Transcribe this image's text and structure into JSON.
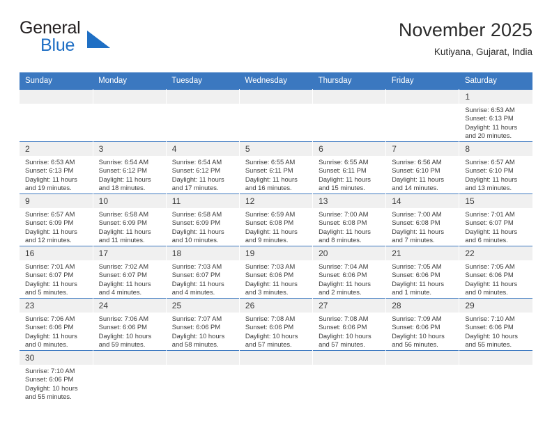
{
  "brand": {
    "name_top": "General",
    "name_bottom": "Blue",
    "triangle_icon": "triangle-icon",
    "color_black": "#231f20",
    "color_blue": "#1f6fc4"
  },
  "header": {
    "title": "November 2025",
    "subtitle": "Kutiyana, Gujarat, India"
  },
  "theme": {
    "header_blue": "#3b78c0",
    "daynum_band": "#f0f0f0",
    "text": "#3a3a3a"
  },
  "weekday_headers": [
    "Sunday",
    "Monday",
    "Tuesday",
    "Wednesday",
    "Thursday",
    "Friday",
    "Saturday"
  ],
  "weeks": [
    [
      {
        "day": "",
        "empty": true,
        "sunrise": "",
        "sunset": "",
        "daylight_line1": "",
        "daylight_line2": ""
      },
      {
        "day": "",
        "empty": true,
        "sunrise": "",
        "sunset": "",
        "daylight_line1": "",
        "daylight_line2": ""
      },
      {
        "day": "",
        "empty": true,
        "sunrise": "",
        "sunset": "",
        "daylight_line1": "",
        "daylight_line2": ""
      },
      {
        "day": "",
        "empty": true,
        "sunrise": "",
        "sunset": "",
        "daylight_line1": "",
        "daylight_line2": ""
      },
      {
        "day": "",
        "empty": true,
        "sunrise": "",
        "sunset": "",
        "daylight_line1": "",
        "daylight_line2": ""
      },
      {
        "day": "",
        "empty": true,
        "sunrise": "",
        "sunset": "",
        "daylight_line1": "",
        "daylight_line2": ""
      },
      {
        "day": "1",
        "empty": false,
        "sunrise": "Sunrise: 6:53 AM",
        "sunset": "Sunset: 6:13 PM",
        "daylight_line1": "Daylight: 11 hours",
        "daylight_line2": "and 20 minutes."
      }
    ],
    [
      {
        "day": "2",
        "empty": false,
        "sunrise": "Sunrise: 6:53 AM",
        "sunset": "Sunset: 6:13 PM",
        "daylight_line1": "Daylight: 11 hours",
        "daylight_line2": "and 19 minutes."
      },
      {
        "day": "3",
        "empty": false,
        "sunrise": "Sunrise: 6:54 AM",
        "sunset": "Sunset: 6:12 PM",
        "daylight_line1": "Daylight: 11 hours",
        "daylight_line2": "and 18 minutes."
      },
      {
        "day": "4",
        "empty": false,
        "sunrise": "Sunrise: 6:54 AM",
        "sunset": "Sunset: 6:12 PM",
        "daylight_line1": "Daylight: 11 hours",
        "daylight_line2": "and 17 minutes."
      },
      {
        "day": "5",
        "empty": false,
        "sunrise": "Sunrise: 6:55 AM",
        "sunset": "Sunset: 6:11 PM",
        "daylight_line1": "Daylight: 11 hours",
        "daylight_line2": "and 16 minutes."
      },
      {
        "day": "6",
        "empty": false,
        "sunrise": "Sunrise: 6:55 AM",
        "sunset": "Sunset: 6:11 PM",
        "daylight_line1": "Daylight: 11 hours",
        "daylight_line2": "and 15 minutes."
      },
      {
        "day": "7",
        "empty": false,
        "sunrise": "Sunrise: 6:56 AM",
        "sunset": "Sunset: 6:10 PM",
        "daylight_line1": "Daylight: 11 hours",
        "daylight_line2": "and 14 minutes."
      },
      {
        "day": "8",
        "empty": false,
        "sunrise": "Sunrise: 6:57 AM",
        "sunset": "Sunset: 6:10 PM",
        "daylight_line1": "Daylight: 11 hours",
        "daylight_line2": "and 13 minutes."
      }
    ],
    [
      {
        "day": "9",
        "empty": false,
        "sunrise": "Sunrise: 6:57 AM",
        "sunset": "Sunset: 6:09 PM",
        "daylight_line1": "Daylight: 11 hours",
        "daylight_line2": "and 12 minutes."
      },
      {
        "day": "10",
        "empty": false,
        "sunrise": "Sunrise: 6:58 AM",
        "sunset": "Sunset: 6:09 PM",
        "daylight_line1": "Daylight: 11 hours",
        "daylight_line2": "and 11 minutes."
      },
      {
        "day": "11",
        "empty": false,
        "sunrise": "Sunrise: 6:58 AM",
        "sunset": "Sunset: 6:09 PM",
        "daylight_line1": "Daylight: 11 hours",
        "daylight_line2": "and 10 minutes."
      },
      {
        "day": "12",
        "empty": false,
        "sunrise": "Sunrise: 6:59 AM",
        "sunset": "Sunset: 6:08 PM",
        "daylight_line1": "Daylight: 11 hours",
        "daylight_line2": "and 9 minutes."
      },
      {
        "day": "13",
        "empty": false,
        "sunrise": "Sunrise: 7:00 AM",
        "sunset": "Sunset: 6:08 PM",
        "daylight_line1": "Daylight: 11 hours",
        "daylight_line2": "and 8 minutes."
      },
      {
        "day": "14",
        "empty": false,
        "sunrise": "Sunrise: 7:00 AM",
        "sunset": "Sunset: 6:08 PM",
        "daylight_line1": "Daylight: 11 hours",
        "daylight_line2": "and 7 minutes."
      },
      {
        "day": "15",
        "empty": false,
        "sunrise": "Sunrise: 7:01 AM",
        "sunset": "Sunset: 6:07 PM",
        "daylight_line1": "Daylight: 11 hours",
        "daylight_line2": "and 6 minutes."
      }
    ],
    [
      {
        "day": "16",
        "empty": false,
        "sunrise": "Sunrise: 7:01 AM",
        "sunset": "Sunset: 6:07 PM",
        "daylight_line1": "Daylight: 11 hours",
        "daylight_line2": "and 5 minutes."
      },
      {
        "day": "17",
        "empty": false,
        "sunrise": "Sunrise: 7:02 AM",
        "sunset": "Sunset: 6:07 PM",
        "daylight_line1": "Daylight: 11 hours",
        "daylight_line2": "and 4 minutes."
      },
      {
        "day": "18",
        "empty": false,
        "sunrise": "Sunrise: 7:03 AM",
        "sunset": "Sunset: 6:07 PM",
        "daylight_line1": "Daylight: 11 hours",
        "daylight_line2": "and 4 minutes."
      },
      {
        "day": "19",
        "empty": false,
        "sunrise": "Sunrise: 7:03 AM",
        "sunset": "Sunset: 6:06 PM",
        "daylight_line1": "Daylight: 11 hours",
        "daylight_line2": "and 3 minutes."
      },
      {
        "day": "20",
        "empty": false,
        "sunrise": "Sunrise: 7:04 AM",
        "sunset": "Sunset: 6:06 PM",
        "daylight_line1": "Daylight: 11 hours",
        "daylight_line2": "and 2 minutes."
      },
      {
        "day": "21",
        "empty": false,
        "sunrise": "Sunrise: 7:05 AM",
        "sunset": "Sunset: 6:06 PM",
        "daylight_line1": "Daylight: 11 hours",
        "daylight_line2": "and 1 minute."
      },
      {
        "day": "22",
        "empty": false,
        "sunrise": "Sunrise: 7:05 AM",
        "sunset": "Sunset: 6:06 PM",
        "daylight_line1": "Daylight: 11 hours",
        "daylight_line2": "and 0 minutes."
      }
    ],
    [
      {
        "day": "23",
        "empty": false,
        "sunrise": "Sunrise: 7:06 AM",
        "sunset": "Sunset: 6:06 PM",
        "daylight_line1": "Daylight: 11 hours",
        "daylight_line2": "and 0 minutes."
      },
      {
        "day": "24",
        "empty": false,
        "sunrise": "Sunrise: 7:06 AM",
        "sunset": "Sunset: 6:06 PM",
        "daylight_line1": "Daylight: 10 hours",
        "daylight_line2": "and 59 minutes."
      },
      {
        "day": "25",
        "empty": false,
        "sunrise": "Sunrise: 7:07 AM",
        "sunset": "Sunset: 6:06 PM",
        "daylight_line1": "Daylight: 10 hours",
        "daylight_line2": "and 58 minutes."
      },
      {
        "day": "26",
        "empty": false,
        "sunrise": "Sunrise: 7:08 AM",
        "sunset": "Sunset: 6:06 PM",
        "daylight_line1": "Daylight: 10 hours",
        "daylight_line2": "and 57 minutes."
      },
      {
        "day": "27",
        "empty": false,
        "sunrise": "Sunrise: 7:08 AM",
        "sunset": "Sunset: 6:06 PM",
        "daylight_line1": "Daylight: 10 hours",
        "daylight_line2": "and 57 minutes."
      },
      {
        "day": "28",
        "empty": false,
        "sunrise": "Sunrise: 7:09 AM",
        "sunset": "Sunset: 6:06 PM",
        "daylight_line1": "Daylight: 10 hours",
        "daylight_line2": "and 56 minutes."
      },
      {
        "day": "29",
        "empty": false,
        "sunrise": "Sunrise: 7:10 AM",
        "sunset": "Sunset: 6:06 PM",
        "daylight_line1": "Daylight: 10 hours",
        "daylight_line2": "and 55 minutes."
      }
    ],
    [
      {
        "day": "30",
        "empty": false,
        "sunrise": "Sunrise: 7:10 AM",
        "sunset": "Sunset: 6:06 PM",
        "daylight_line1": "Daylight: 10 hours",
        "daylight_line2": "and 55 minutes."
      },
      {
        "day": "",
        "empty": true,
        "sunrise": "",
        "sunset": "",
        "daylight_line1": "",
        "daylight_line2": ""
      },
      {
        "day": "",
        "empty": true,
        "sunrise": "",
        "sunset": "",
        "daylight_line1": "",
        "daylight_line2": ""
      },
      {
        "day": "",
        "empty": true,
        "sunrise": "",
        "sunset": "",
        "daylight_line1": "",
        "daylight_line2": ""
      },
      {
        "day": "",
        "empty": true,
        "sunrise": "",
        "sunset": "",
        "daylight_line1": "",
        "daylight_line2": ""
      },
      {
        "day": "",
        "empty": true,
        "sunrise": "",
        "sunset": "",
        "daylight_line1": "",
        "daylight_line2": ""
      },
      {
        "day": "",
        "empty": true,
        "sunrise": "",
        "sunset": "",
        "daylight_line1": "",
        "daylight_line2": ""
      }
    ]
  ]
}
